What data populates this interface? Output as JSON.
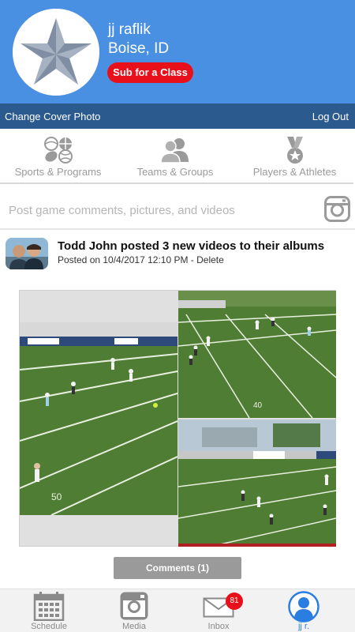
{
  "profile": {
    "name": "jj raflik",
    "location": "Boise, ID",
    "sub_button": "Sub for a Class"
  },
  "cover_bar": {
    "change_cover": "Change Cover Photo",
    "logout": "Log Out"
  },
  "categories": [
    {
      "label": "Sports & Programs",
      "icon": "sports-balls-icon"
    },
    {
      "label": "Teams & Groups",
      "icon": "people-icon"
    },
    {
      "label": "Players & Athletes",
      "icon": "medal-icon"
    }
  ],
  "composer": {
    "placeholder": "Post game comments, pictures, and videos",
    "icon": "camera-icon"
  },
  "feed": {
    "title": "Todd John posted 3 new videos to their albums",
    "posted_on": "Posted on 10/4/2017 12:10 PM - ",
    "delete": "Delete",
    "comments_button": "Comments (1)"
  },
  "nav": [
    {
      "label": "Schedule",
      "icon": "calendar-icon"
    },
    {
      "label": "Media",
      "icon": "camera-icon"
    },
    {
      "label": "Inbox",
      "icon": "mail-icon",
      "badge": "81"
    },
    {
      "label": "jj r.",
      "icon": "user-icon",
      "active": true
    }
  ],
  "colors": {
    "header_blue": "#4a90e2",
    "cover_bar": "#2a5a8e",
    "accent_red": "#e8101a",
    "active_blue": "#2a7de1"
  }
}
